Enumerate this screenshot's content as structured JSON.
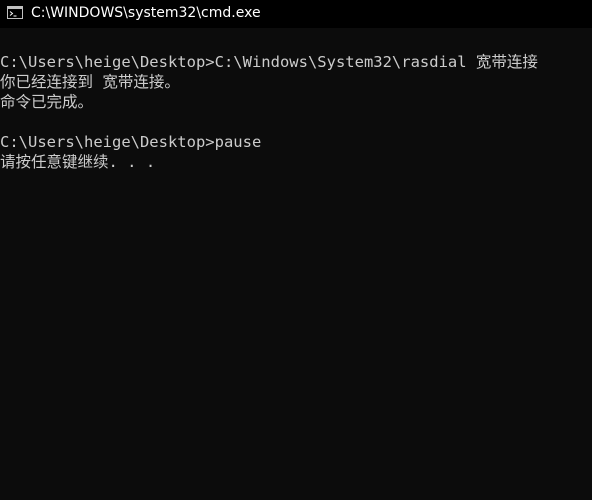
{
  "window": {
    "title": "C:\\WINDOWS\\system32\\cmd.exe",
    "icon": "cmd-icon"
  },
  "console": {
    "lines": [
      "C:\\Users\\heige\\Desktop>C:\\Windows\\System32\\rasdial 宽带连接",
      "你已经连接到 宽带连接。",
      "命令已完成。",
      "",
      "C:\\Users\\heige\\Desktop>pause",
      "请按任意键继续. . ."
    ]
  },
  "colors": {
    "background": "#0c0c0c",
    "titlebar": "#000000",
    "text": "#cccccc",
    "title_text": "#ffffff"
  }
}
